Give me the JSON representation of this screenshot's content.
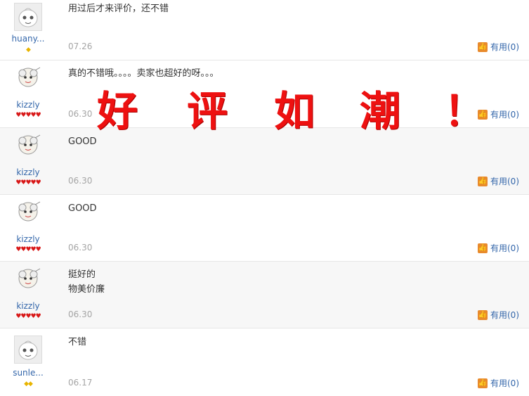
{
  "reviews": [
    {
      "username": "huany...",
      "content": "用过后才来评价，还不错",
      "date": "07.26",
      "useful": "有用(0)",
      "avatar": "default-avatar-icon",
      "badges": "◆"
    },
    {
      "username": "kizzly",
      "content": "真的不错哦。。。。卖家也超好的呀。。。",
      "date": "06.30",
      "useful": "有用(0)",
      "avatar": "sheep-avatar-icon",
      "badges": "♥♥♥♥♥"
    },
    {
      "username": "kizzly",
      "content": "GOOD",
      "date": "06.30",
      "useful": "有用(0)",
      "avatar": "sheep-avatar-icon",
      "badges": "♥♥♥♥♥"
    },
    {
      "username": "kizzly",
      "content": "GOOD",
      "date": "06.30",
      "useful": "有用(0)",
      "avatar": "sheep-avatar-icon",
      "badges": "♥♥♥♥♥"
    },
    {
      "username": "kizzly",
      "content": "挺好的\n物美价廉",
      "date": "06.30",
      "useful": "有用(0)",
      "avatar": "sheep-avatar-icon",
      "badges": "♥♥♥♥♥"
    },
    {
      "username": "sunle...",
      "content": "不错",
      "date": "06.17",
      "useful": "有用(0)",
      "avatar": "default-avatar-icon",
      "badges": "◆◆"
    }
  ],
  "overlay": {
    "chars": [
      "好",
      "评",
      "如",
      "潮",
      "！"
    ],
    "color": "#ee1111"
  },
  "colors": {
    "username": "#3366aa",
    "date": "#a5a5a5",
    "thumb": "#e88a2c",
    "alt_row": "#f7f7f7"
  }
}
